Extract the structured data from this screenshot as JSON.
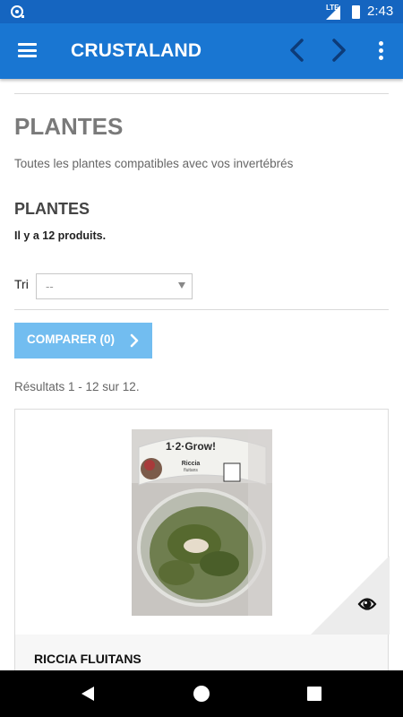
{
  "status_bar": {
    "network": "LTE",
    "time": "2:43"
  },
  "app_bar": {
    "title": "CRUSTALAND",
    "menu_icon": "hamburger-icon",
    "back_icon": "chevron-left-icon",
    "forward_icon": "chevron-right-icon",
    "overflow_icon": "more-vert-icon"
  },
  "page": {
    "title": "PLANTES",
    "description": "Toutes les plantes compatibles avec vos invertébrés",
    "section_title": "PLANTES",
    "product_count": "Il y a 12 produits."
  },
  "sort": {
    "label": "Tri",
    "selected": "--"
  },
  "compare": {
    "label": "COMPARER (0)"
  },
  "results": {
    "text": "Résultats 1 - 12 sur 12."
  },
  "product": {
    "name": "RICCIA FLUITANS",
    "image_label_brand": "1·2·Grow!",
    "image_label_name": "Riccia",
    "image_label_sub": "fluitans",
    "quickview_icon": "eye-icon"
  },
  "colors": {
    "status_bar": "#1565c0",
    "app_bar": "#1976d2",
    "compare_button": "#72bdf0",
    "title_gray": "#7a7a7a"
  }
}
